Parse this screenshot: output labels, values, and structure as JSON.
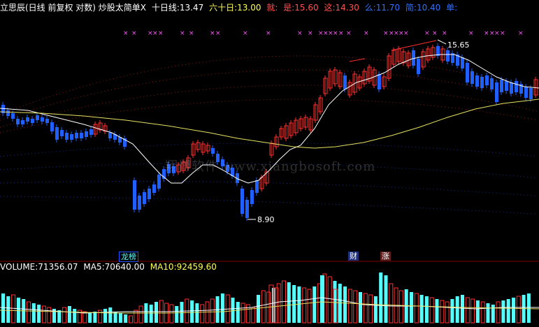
{
  "header": {
    "title": "立思辰(日线 前复权 对数) 炒股太简单X",
    "ma10_label": "十日线:",
    "ma10_value": "13.47",
    "ma60_label": "六十日:",
    "ma60_value": "13.00",
    "jiu_label": "就:",
    "shi_label": "是:",
    "shi_value": "15.60",
    "zhe_label": "这:",
    "zhe_value": "14.30",
    "me_label": "么:",
    "me_value": "11.70",
    "jian_label": "简:",
    "jian_value": "10.40",
    "dan_label": "单:"
  },
  "annotations": {
    "high_label": "15.65",
    "low_label": "8.90"
  },
  "tags": {
    "leaderboard": "龙榜",
    "finance": "财",
    "rise": "涨"
  },
  "watermark": "翔博软件 www.xiangbosoft.com",
  "volume_header": {
    "volume_label": "VOLUME:",
    "volume_value": "71356.07",
    "ma5_label": "MA5:",
    "ma5_value": "70640.00",
    "ma10_label": "MA10:",
    "ma10_value": "92459.60"
  },
  "colors": {
    "up": "#ff3030",
    "down": "#2060ff",
    "cyan": "#55ffff",
    "yellow": "#ffff55",
    "magenta": "#ff55ff",
    "ma_white": "#ffffff",
    "ma_yellow": "#e6e060"
  },
  "chart_data": {
    "type": "candlestick",
    "log_scale": true,
    "series_note": "daily candles with volume; overlay MA lines",
    "high": 15.65,
    "low": 8.9
  }
}
